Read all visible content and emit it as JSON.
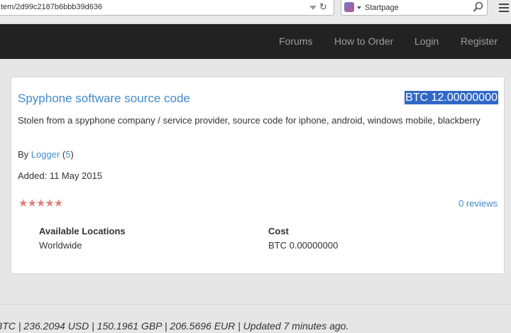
{
  "browser": {
    "url": "tem/2d99c2187b6bbb39d636",
    "search_engine": "Startpage",
    "icons": [
      "dropdown-arrow-icon",
      "reload-icon",
      "startpage-icon",
      "search-icon",
      "hamburger-menu-icon"
    ]
  },
  "nav": {
    "items": [
      "Forums",
      "How to Order",
      "Login",
      "Register"
    ]
  },
  "listing": {
    "title": "Spyphone software source code",
    "price": "BTC 12.00000000",
    "description": "Stolen from a spyphone company / service provider, source code for iphone, android, windows mobile, blackberry",
    "by_prefix": "By",
    "vendor": "Logger",
    "vendor_rating": "5",
    "added_label": "Added:",
    "added_date": "11 May 2015",
    "stars": "★★★★★",
    "reviews": "0 reviews",
    "locations_header": "Available Locations",
    "location": "Worldwide",
    "cost_header": "Cost",
    "cost": "BTC 0.00000000"
  },
  "footer": {
    "rates": "BTC | 236.2094 USD | 150.1961 GBP | 206.5696 EUR | Updated 7 minutes ago."
  },
  "colors": {
    "navbar": "#222222",
    "link": "#428bca",
    "highlight": "#3168c6",
    "stars": "#d9534f"
  }
}
